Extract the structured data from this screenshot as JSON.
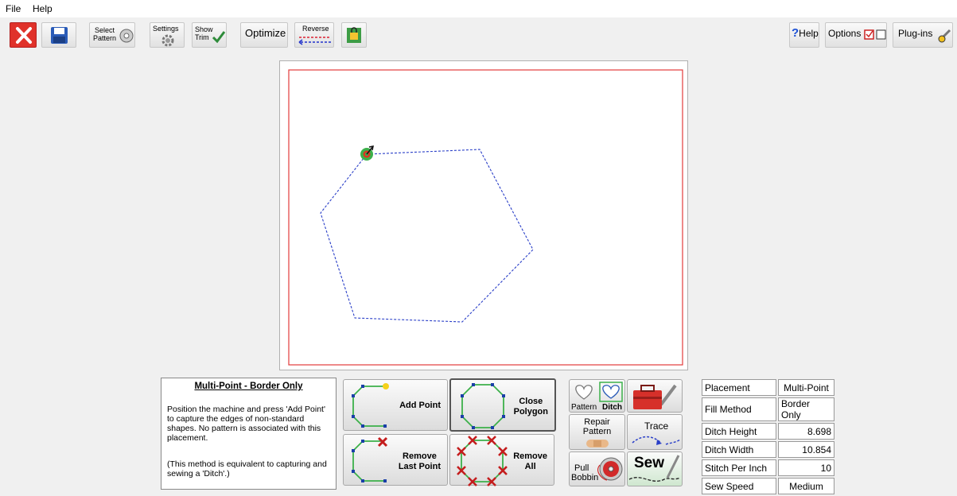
{
  "menu": {
    "file": "File",
    "help": "Help"
  },
  "toolbar": {
    "select_pattern": [
      "Select",
      "Pattern"
    ],
    "settings": "Settings",
    "show_trim": [
      "Show",
      "Trim"
    ],
    "optimize": "Optimize",
    "reverse": "Reverse",
    "help": "Help",
    "help_mark": "?",
    "options": "Options",
    "plugins": "Plug-ins"
  },
  "info": {
    "title": "Multi-Point - Border Only",
    "body": "Position the machine and press 'Add Point' to capture the edges of non-standard shapes. No pattern is associated with this placement.",
    "note": "(This method is equivalent to capturing and sewing a 'Ditch'.)"
  },
  "actions": {
    "add_point": "Add Point",
    "close_polygon": [
      "Close",
      "Polygon"
    ],
    "remove_last": [
      "Remove",
      "Last Point"
    ],
    "remove_all": [
      "Remove",
      "All"
    ]
  },
  "side": {
    "pattern": "Pattern",
    "ditch": "Ditch",
    "repair": [
      "Repair",
      "Pattern"
    ],
    "trace": "Trace",
    "pull": [
      "Pull",
      "Bobbin"
    ],
    "sew": "Sew"
  },
  "props": [
    {
      "key": "Placement",
      "value": "Multi-Point"
    },
    {
      "key": "Fill Method",
      "value": "Border Only"
    },
    {
      "key": "Ditch Height",
      "value": "8.698"
    },
    {
      "key": "Ditch Width",
      "value": "10.854"
    },
    {
      "key": "Stitch Per Inch",
      "value": "10"
    },
    {
      "key": "Sew Speed",
      "value": "Medium"
    }
  ],
  "colors": {
    "accent_red": "#e0322a",
    "path_blue": "#2a3fc8",
    "polygon_green": "#3cb04a",
    "border_red": "#e23b3b"
  }
}
